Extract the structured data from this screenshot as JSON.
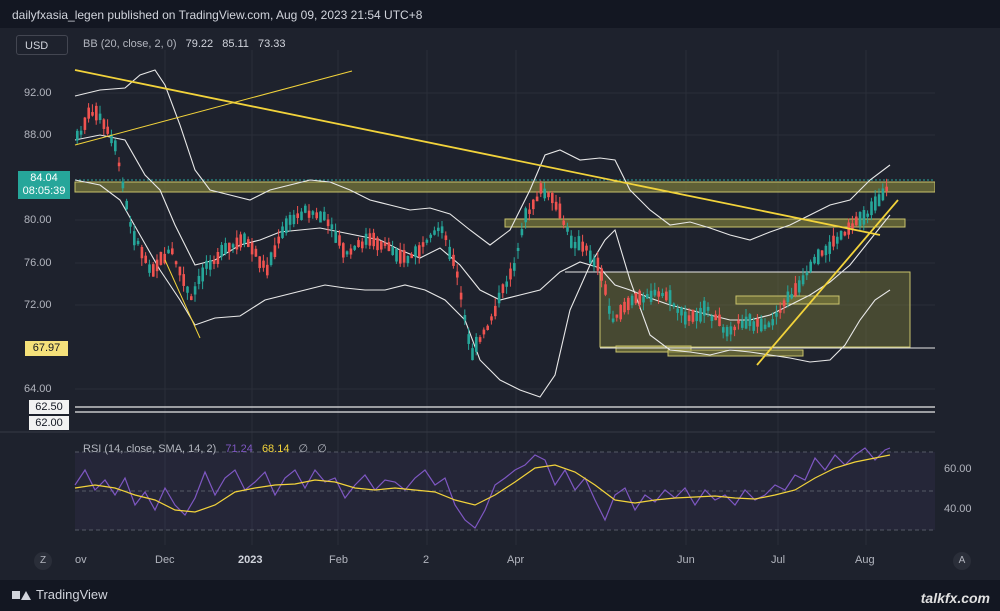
{
  "header": {
    "publish_info": "dailyfxasia_legen published on TradingView.com, Aug 09, 2023 21:54 UTC+8"
  },
  "toolbar": {
    "currency": "USD"
  },
  "indicators": {
    "bb": {
      "label": "BB (20, close, 2, 0)",
      "values": [
        "79.22",
        "85.11",
        "73.33"
      ]
    },
    "rsi": {
      "label": "RSI (14, close, SMA, 14, 2)",
      "values": [
        "71.24",
        "68.14",
        "∅",
        "∅"
      ]
    }
  },
  "price_axis": {
    "ticks": [
      "92.00",
      "88.00",
      "80.00",
      "76.00",
      "72.00",
      "64.00"
    ],
    "current_price": "84.04",
    "countdown": "08:05:39",
    "levels": [
      "67.97",
      "62.50",
      "62.00"
    ]
  },
  "rsi_axis": {
    "ticks": [
      "60.00",
      "40.00"
    ]
  },
  "time_axis": {
    "labels": [
      "ov",
      "Dec",
      "2023",
      "Feb",
      "2",
      "Apr",
      "Jun",
      "Jul",
      "Aug"
    ],
    "left_button": "Z",
    "right_button": "A"
  },
  "footer": {
    "brand": "TradingView",
    "watermark": "talkfx.com"
  },
  "colors": {
    "background": "#1e222d",
    "up": "#26a69a",
    "down": "#ef5350",
    "band": "#e8e8e8",
    "trendline": "#f2d33b",
    "zone_fill": "#7a7a3a",
    "rsi_line": "#7e57c2",
    "rsi_ma": "#f2d33b",
    "price_tag": "#26a69a"
  }
}
